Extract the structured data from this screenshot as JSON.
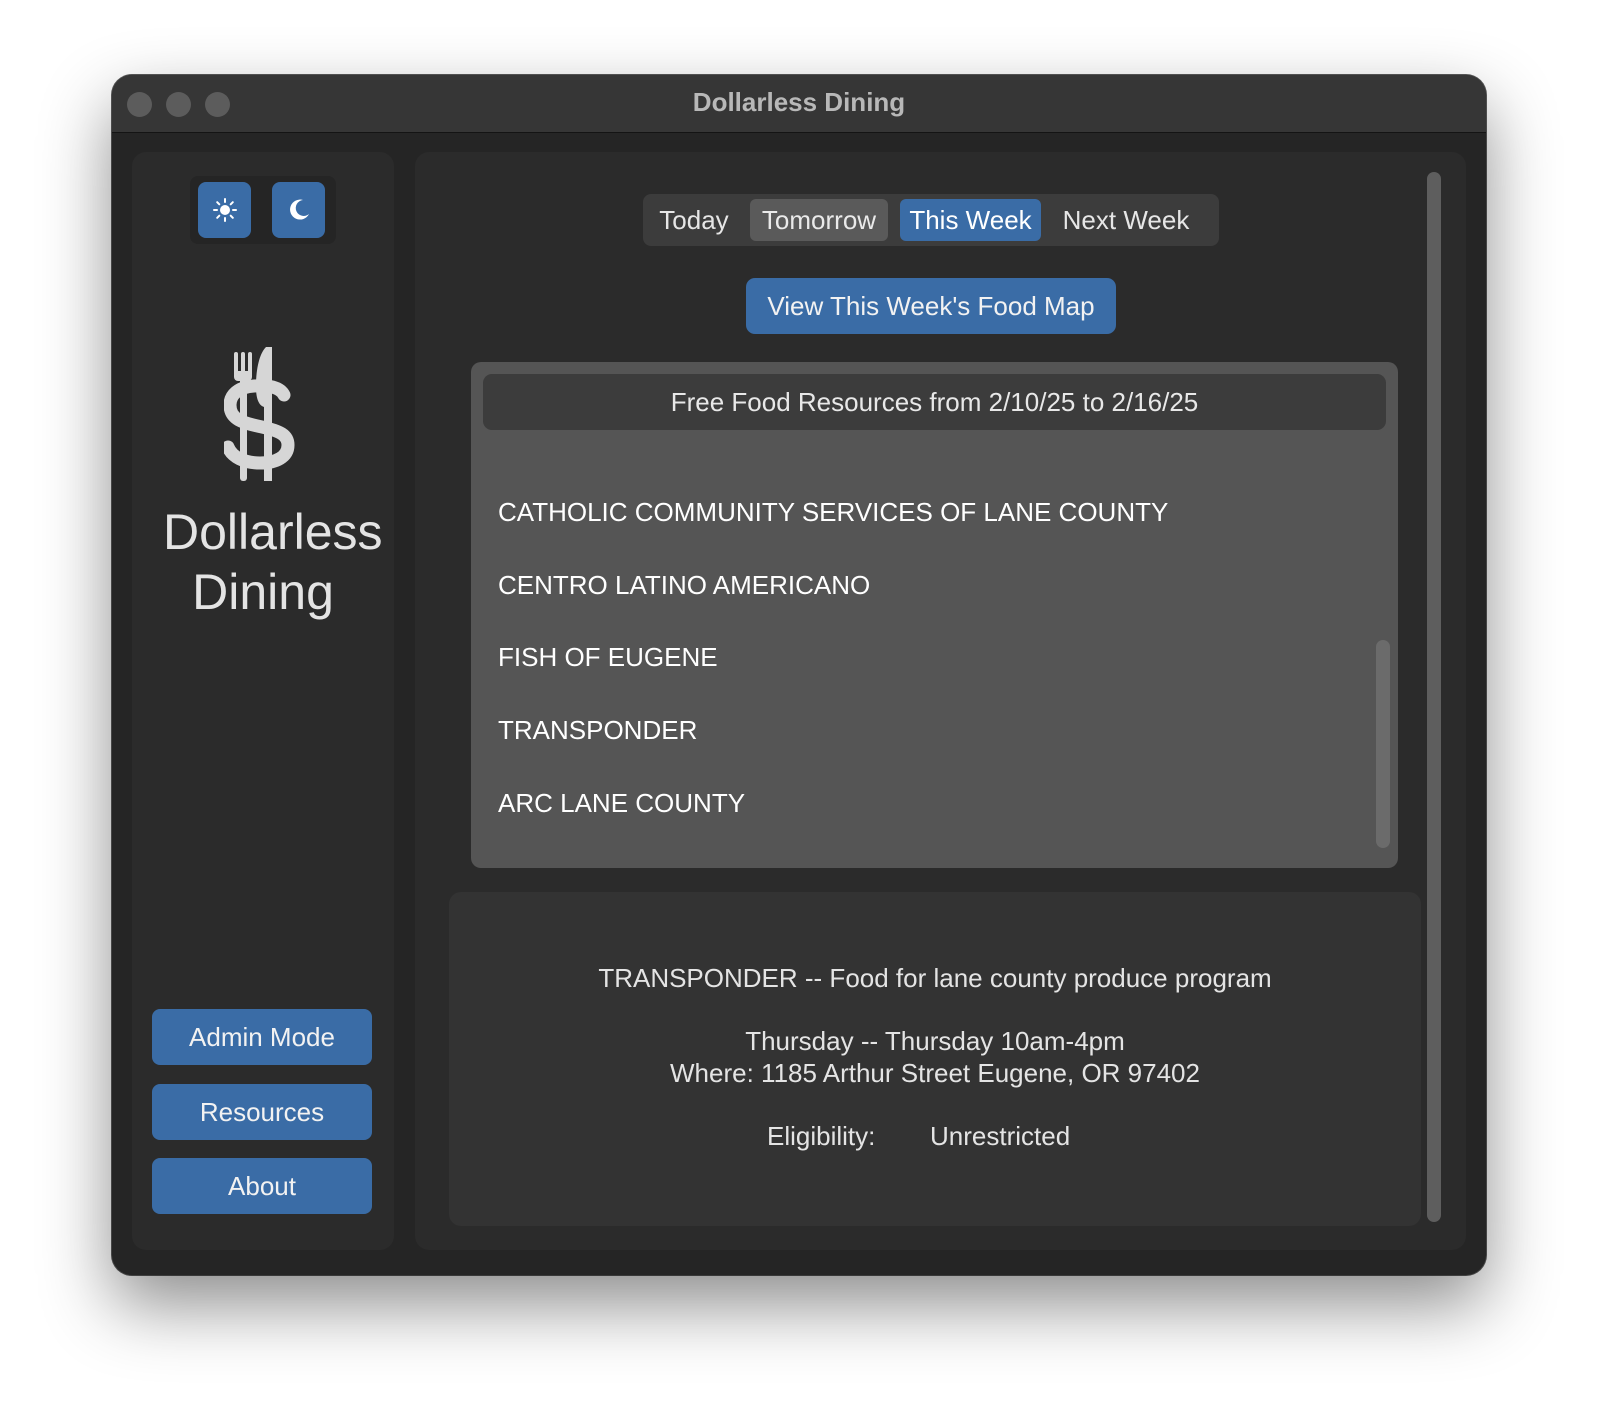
{
  "window": {
    "title": "Dollarless Dining"
  },
  "sidebar": {
    "theme": {
      "light_icon": "sun-icon",
      "dark_icon": "moon-icon"
    },
    "logo_icon": "fork-knife-dollar-logo",
    "app_name": "Dollarless Dining",
    "buttons": {
      "admin": "Admin Mode",
      "resources": "Resources",
      "about": "About"
    }
  },
  "main": {
    "tabs": [
      {
        "label": "Today",
        "state": "normal"
      },
      {
        "label": "Tomorrow",
        "state": "hover"
      },
      {
        "label": "This Week",
        "state": "selected"
      },
      {
        "label": "Next Week",
        "state": "normal"
      }
    ],
    "map_button": "View This Week's Food Map",
    "list": {
      "header": "Free Food Resources from 2/10/25 to 2/16/25",
      "items": [
        "CATHOLIC COMMUNITY SERVICES OF LANE COUNTY",
        "CENTRO LATINO AMERICANO",
        "FISH OF EUGENE",
        "TRANSPONDER",
        "ARC LANE COUNTY"
      ]
    },
    "detail": {
      "title": "TRANSPONDER -- Food for lane county produce program",
      "when": "Thursday -- Thursday 10am-4pm",
      "where": "Where: 1185 Arthur Street Eugene, OR 97402",
      "eligibility_label": "Eligibility:",
      "eligibility_value": "Unrestricted"
    }
  },
  "colors": {
    "accent": "#3a6ca6",
    "window_bg": "#252525",
    "panel_bg": "#2b2b2b",
    "list_bg": "#555555"
  }
}
